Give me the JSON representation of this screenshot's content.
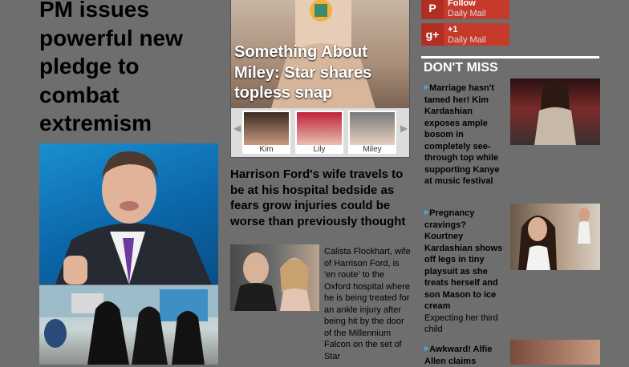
{
  "main_story": {
    "headline": "PM issues powerful new pledge to combat extremism"
  },
  "carousel": {
    "title": "Something About Miley: Star shares topless snap",
    "thumbs": [
      {
        "label": "Kim"
      },
      {
        "label": "Lily"
      },
      {
        "label": "Miley"
      }
    ]
  },
  "article": {
    "headline": "Harrison Ford's wife travels to be at his hospital bedside as fears grow injuries could be worse than previously thought",
    "body": "Calista Flockhart, wife of Harrison Ford, is 'en route' to the Oxford hospital where he is being treated for an ankle injury after being hit by the door of the Millennium Falcon on the set of Star"
  },
  "social": {
    "pinterest": {
      "action": "Follow",
      "name": "Daily Mail"
    },
    "gplus": {
      "action": "+1",
      "name": "Daily Mail"
    }
  },
  "dont_miss": {
    "label": "DON'T MISS",
    "items": [
      {
        "headline": "Marriage hasn't tamed her! Kim Kardashian exposes ample bosom in completely see-through top while supporting Kanye at music festival",
        "sub": ""
      },
      {
        "headline": "Pregnancy cravings? Kourtney Kardashian shows off legs in tiny playsuit as she treats herself and son Mason to ice cream",
        "sub": "Expecting her third child"
      },
      {
        "headline": "Awkward! Alfie Allen claims",
        "sub": ""
      }
    ]
  },
  "colors": {
    "page_bg": "#6e6e6e",
    "social_red": "#c63a2b",
    "accent_blue": "#4aa3d9"
  }
}
